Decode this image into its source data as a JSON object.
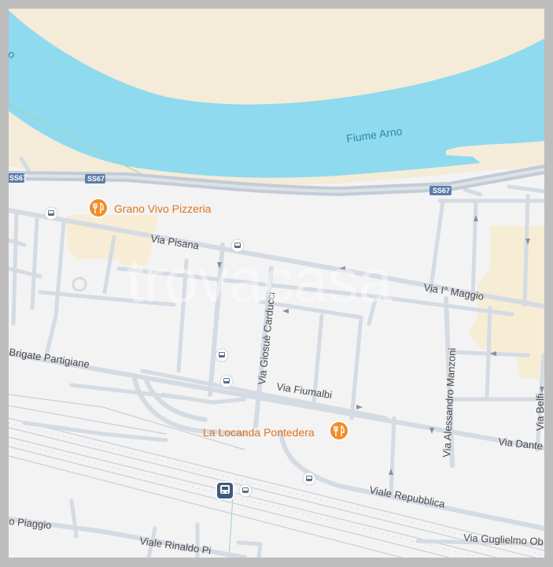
{
  "map": {
    "water": {
      "name": "Fiume Arno",
      "edge_fragment": "o"
    },
    "highway_shields": [
      "SS67",
      "SS67",
      "SS67"
    ],
    "streets": {
      "via_pisana": "Via Pisana",
      "via_i_maggio": "Via I° Maggio",
      "brigate_partigiane": "Brigate Partigiane",
      "via_giosue_carducci": "Via Giosuè Carducci",
      "via_fiumalbi": "Via Fiumalbi",
      "via_alessandro_manzoni": "Via Alessandro Manzoni",
      "via_dante": "Via Dante",
      "viale_repubblica": "Viale Repubblica",
      "via_piaggio": "o Piaggio",
      "viale_rinaldo": "Viale Rinaldo Pi",
      "via_guglielmo": "Via Guglielmo Ob",
      "via_belfiore": "Via Belfi"
    },
    "pois": [
      {
        "name": "Grano Vivo Pizzeria",
        "icon": "restaurant-icon"
      },
      {
        "name": "La Locanda Pontedera",
        "icon": "restaurant-icon"
      }
    ],
    "transit_icons": [
      "bus-stop-icon",
      "bus-stop-icon",
      "bus-stop-icon",
      "bus-stop-icon",
      "bus-stop-icon",
      "bus-stop-icon",
      "train-station-icon"
    ],
    "watermark": "trovacasa",
    "colors": {
      "water": "#8fdaee",
      "sand": "#f4ebd8",
      "land": "#f3f3f4",
      "road": "#d4dbe3",
      "highway": "#c3ccd6",
      "building": "#f6edd4",
      "poi": "#f28c28",
      "frame": "#bdbdbd"
    }
  }
}
